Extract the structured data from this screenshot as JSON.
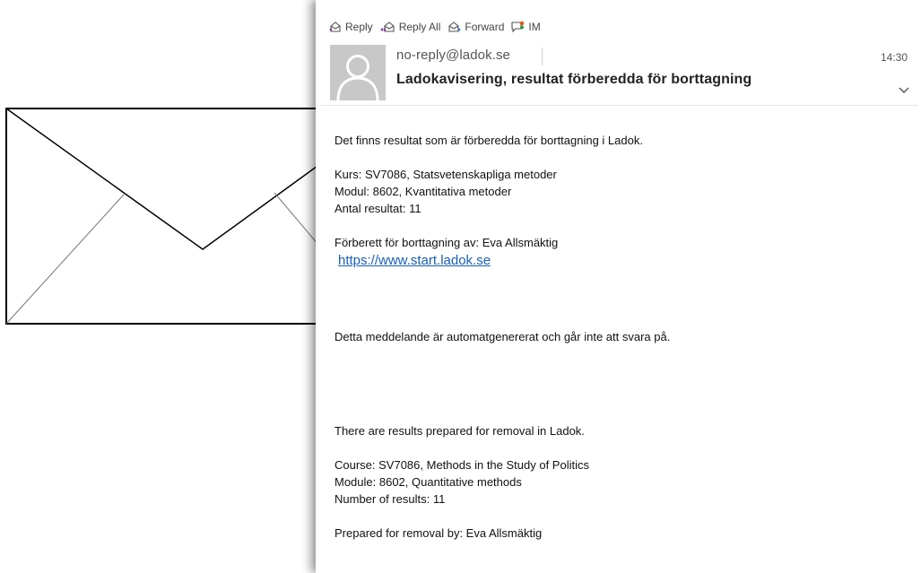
{
  "toolbar": {
    "reply_label": "Reply",
    "reply_all_label": "Reply All",
    "forward_label": "Forward",
    "im_label": "IM"
  },
  "message": {
    "sender": "no-reply@ladok.se",
    "time": "14:30",
    "subject": "Ladokavisering, resultat förberedda för borttagning"
  },
  "body_sv": {
    "intro": "Det finns resultat som är förberedda för borttagning i Ladok.",
    "course": "Kurs: SV7086, Statsvetenskapliga metoder",
    "module": "Modul: 8602, Kvantitativa metoder",
    "count": "Antal resultat: 11",
    "prepared_by": "Förberett för borttagning av: Eva Allsmäktig",
    "link": "https://www.start.ladok.se",
    "auto_note": "Detta meddelande är automatgenererat och går inte att svara på."
  },
  "body_en": {
    "intro": "There are results prepared for removal in Ladok.",
    "course": "Course: SV7086, Methods in the Study of Politics",
    "module": "Module: 8602, Quantitative methods",
    "count": "Number of results: 11",
    "prepared_by": "Prepared for removal by: Eva Allsmäktig"
  },
  "colors": {
    "link": "#1a5fb4",
    "avatar_bg": "#c8c8c8",
    "reply_accent": "#7b3fa0",
    "forward_accent": "#2a6fc9"
  },
  "icons": [
    "reply-icon",
    "reply-all-icon",
    "forward-icon",
    "im-icon",
    "avatar-person-icon",
    "chevron-down-icon",
    "envelope-icon"
  ]
}
